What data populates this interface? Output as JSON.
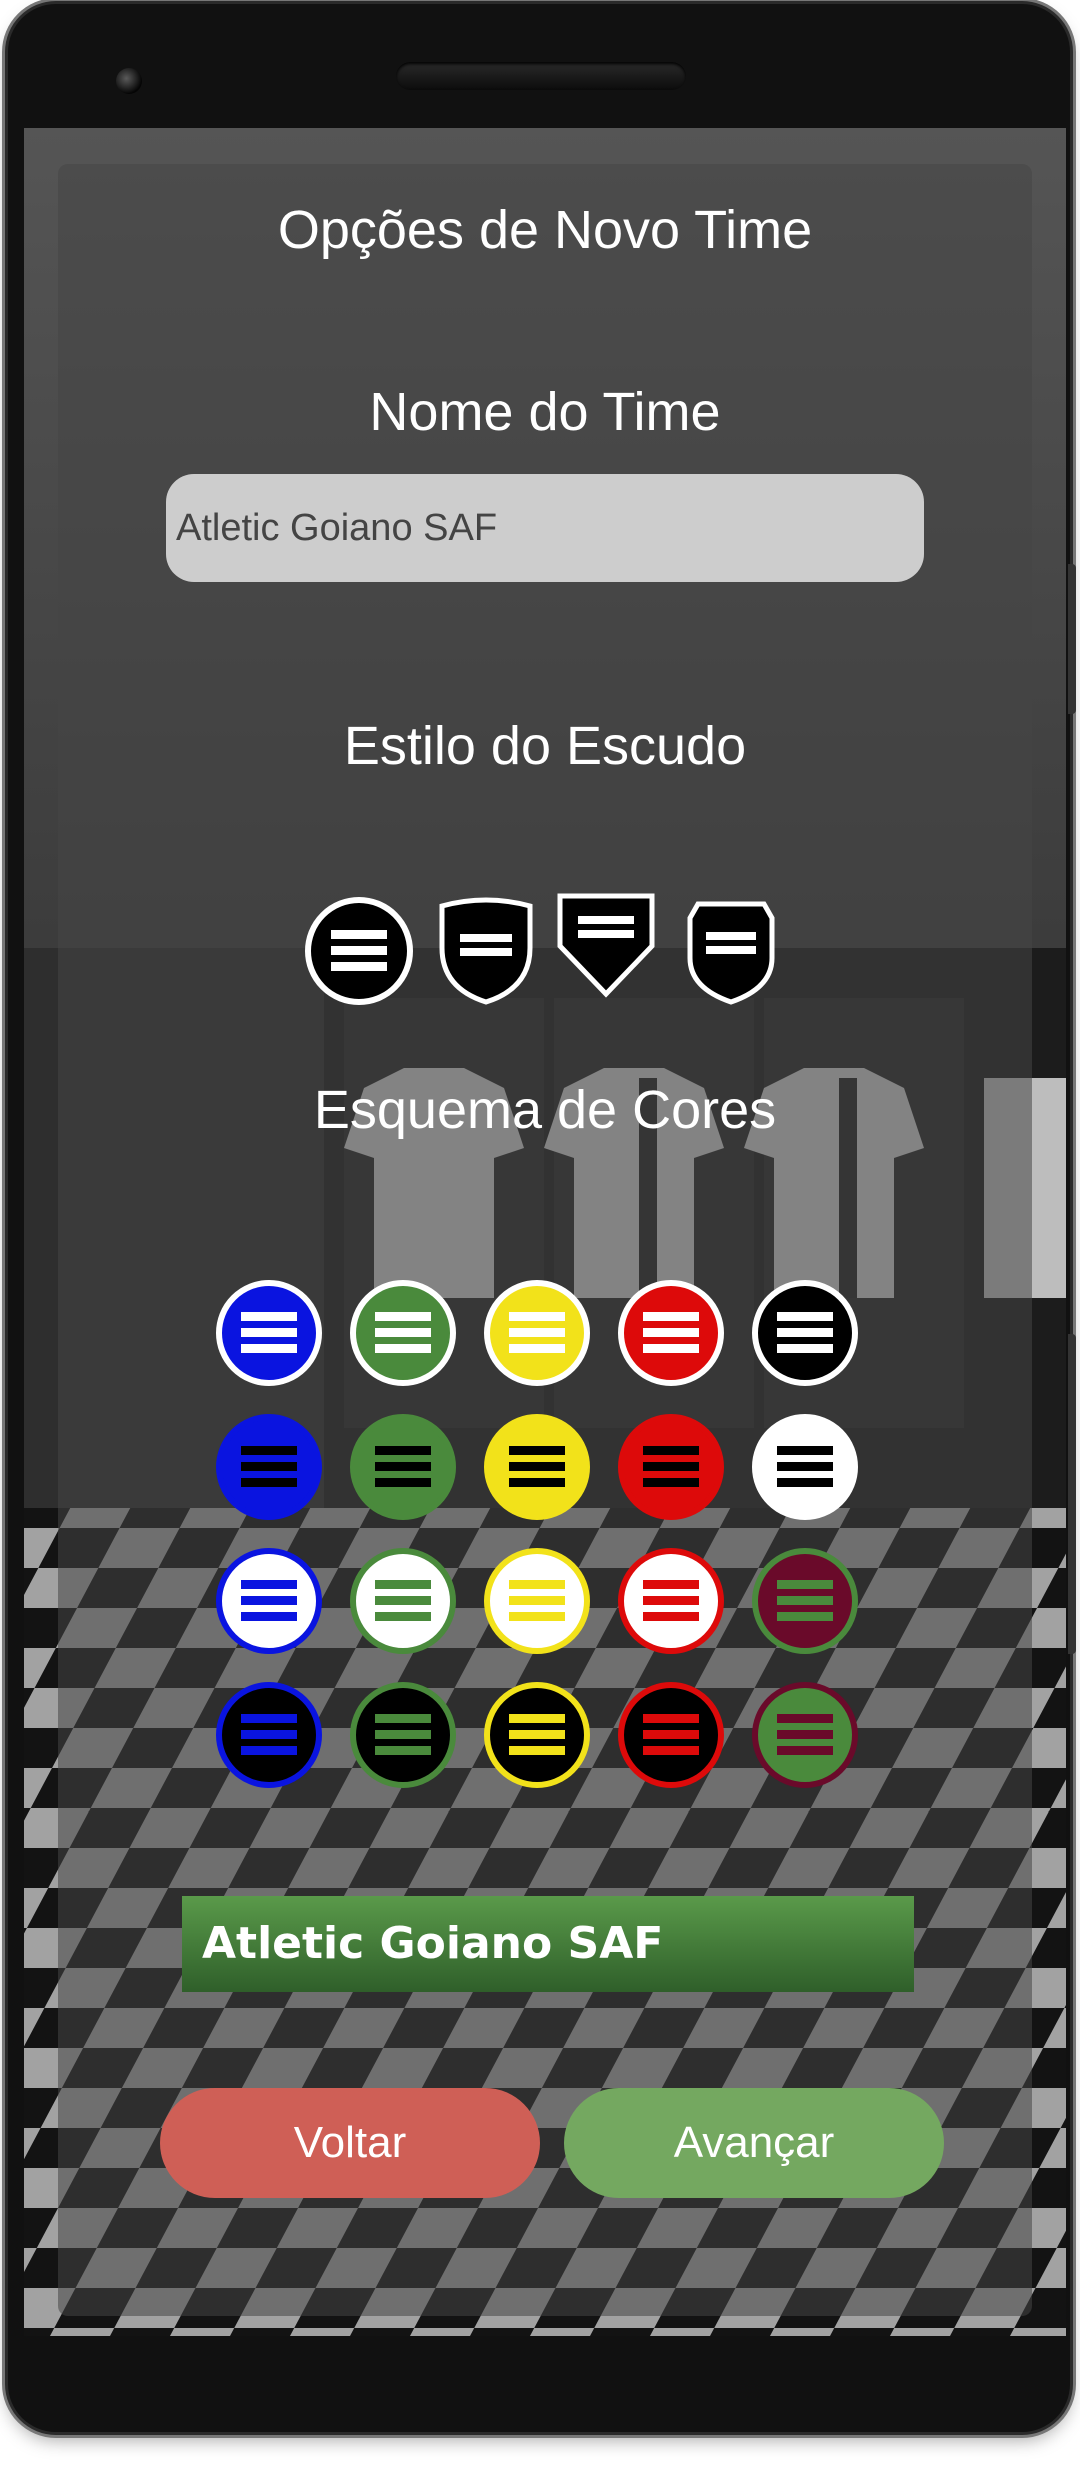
{
  "screen": {
    "title": "Opções de Novo Time",
    "team_name": {
      "heading": "Nome do Time",
      "value": "Atletic Goiano SAF"
    },
    "crest_style": {
      "heading": "Estilo do Escudo",
      "options": [
        "round-shield-icon",
        "classic-shield-icon",
        "pennant-shield-icon",
        "badge-shield-icon"
      ]
    },
    "color_scheme": {
      "heading": "Esquema de Cores",
      "rows": [
        [
          {
            "name": "blue-white",
            "ring": "#ffffff",
            "fill": "#0a14e0",
            "stripes": "#ffffff"
          },
          {
            "name": "green-white",
            "ring": "#ffffff",
            "fill": "#4a8a3c",
            "stripes": "#ffffff"
          },
          {
            "name": "yellow-white",
            "ring": "#ffffff",
            "fill": "#f2e21a",
            "stripes": "#ffffff"
          },
          {
            "name": "red-white",
            "ring": "#ffffff",
            "fill": "#dd0a0a",
            "stripes": "#ffffff"
          },
          {
            "name": "black-white",
            "ring": "#ffffff",
            "fill": "#000000",
            "stripes": "#ffffff"
          }
        ],
        [
          {
            "name": "blue-black",
            "ring": "#0a14e0",
            "fill": "#0a14e0",
            "stripes": "#000000"
          },
          {
            "name": "green-black",
            "ring": "#4a8a3c",
            "fill": "#4a8a3c",
            "stripes": "#000000"
          },
          {
            "name": "yellow-black",
            "ring": "#f2e21a",
            "fill": "#f2e21a",
            "stripes": "#000000"
          },
          {
            "name": "red-black",
            "ring": "#dd0a0a",
            "fill": "#dd0a0a",
            "stripes": "#000000"
          },
          {
            "name": "white-black",
            "ring": "#ffffff",
            "fill": "#ffffff",
            "stripes": "#000000"
          }
        ],
        [
          {
            "name": "white-blue",
            "ring": "#0a14e0",
            "fill": "#ffffff",
            "stripes": "#0a14e0"
          },
          {
            "name": "white-green",
            "ring": "#4a8a3c",
            "fill": "#ffffff",
            "stripes": "#4a8a3c"
          },
          {
            "name": "white-yellow",
            "ring": "#f2e21a",
            "fill": "#ffffff",
            "stripes": "#f2e21a"
          },
          {
            "name": "white-red",
            "ring": "#dd0a0a",
            "fill": "#ffffff",
            "stripes": "#dd0a0a"
          },
          {
            "name": "maroon-green",
            "ring": "#4a8a3c",
            "fill": "#6a0a2a",
            "stripes": "#4a8a3c"
          }
        ],
        [
          {
            "name": "black-blue",
            "ring": "#0a14e0",
            "fill": "#000000",
            "stripes": "#0a14e0"
          },
          {
            "name": "black-green",
            "ring": "#4a8a3c",
            "fill": "#000000",
            "stripes": "#4a8a3c"
          },
          {
            "name": "black-yellow",
            "ring": "#f2e21a",
            "fill": "#000000",
            "stripes": "#f2e21a"
          },
          {
            "name": "black-red",
            "ring": "#dd0a0a",
            "fill": "#000000",
            "stripes": "#dd0a0a"
          },
          {
            "name": "green-maroon",
            "ring": "#6a0a2a",
            "fill": "#4a8a3c",
            "stripes": "#6a0a2a"
          }
        ]
      ]
    },
    "preview": {
      "label": "Atletic Goiano SAF",
      "color": "#4a8a3c"
    },
    "buttons": {
      "back": "Voltar",
      "next": "Avançar",
      "back_color": "#cf5f56",
      "next_color": "#74a860"
    }
  }
}
